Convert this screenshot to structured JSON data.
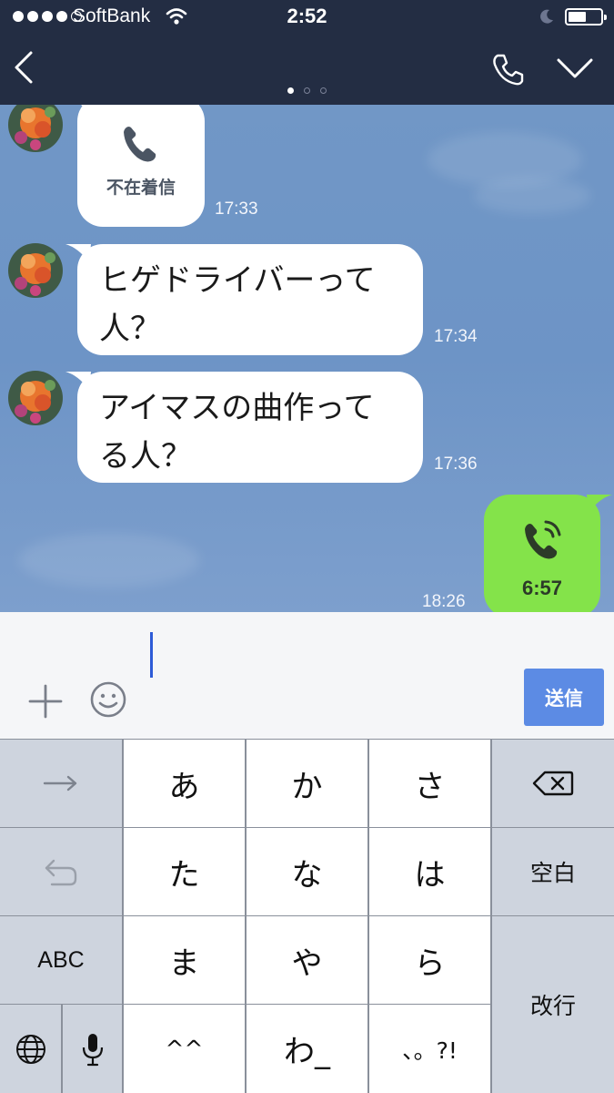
{
  "status_bar": {
    "carrier": "SoftBank",
    "time": "2:52",
    "battery_level": 0.55,
    "signal_bars": 4
  },
  "header": {
    "back_icon": "chevron-left-icon",
    "call_icon": "phone-icon",
    "menu_icon": "chevron-down-icon",
    "page_count": 3,
    "active_page": 1
  },
  "messages": [
    {
      "type": "missed-call",
      "label": "不在着信",
      "time": "17:33"
    },
    {
      "type": "text",
      "lines": [
        "ヒゲドライバーって",
        "人？"
      ],
      "time": "17:34"
    },
    {
      "type": "text",
      "lines": [
        "アイマスの曲作って",
        "る人？"
      ],
      "time": "17:36"
    },
    {
      "type": "outgoing-call",
      "duration": "6:57",
      "time": "18:26"
    }
  ],
  "input": {
    "plus_icon": "plus-icon",
    "emoji_icon": "smiley-icon",
    "send_label": "送信"
  },
  "keyboard": {
    "row1": [
      "あ",
      "か",
      "さ"
    ],
    "row2": [
      "た",
      "な",
      "は"
    ],
    "row3": [
      "ま",
      "や",
      "ら"
    ],
    "row4": [
      "^^",
      "わ_",
      "、。?!"
    ],
    "abc_label": "ABC",
    "space_label": "空白",
    "return_label": "改行",
    "icons": [
      "arrow-right-icon",
      "undo-icon",
      "backspace-icon",
      "globe-icon",
      "microphone-icon"
    ]
  },
  "colors": {
    "header_bg": "#232d43",
    "chat_bg": "#7197c6",
    "outgoing_bubble": "#84e34a",
    "send_button": "#5c8be4"
  }
}
